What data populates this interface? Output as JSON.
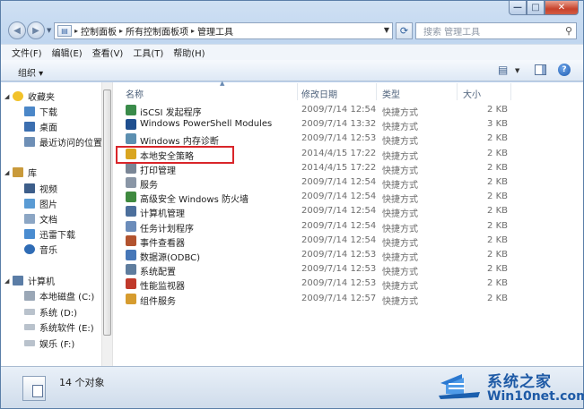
{
  "window": {
    "controls": {
      "minimize": "—",
      "maximize": "□",
      "close": "✕"
    },
    "buttons": {
      "back": "◀",
      "forward": "▶"
    }
  },
  "address": {
    "breadcrumbs": [
      "控制面板",
      "所有控制面板项",
      "管理工具"
    ],
    "separator": "▸",
    "root_icon": "folder-icon"
  },
  "search": {
    "placeholder": "搜索 管理工具",
    "icon": "magnifier-icon"
  },
  "menu": [
    "文件(F)",
    "编辑(E)",
    "查看(V)",
    "工具(T)",
    "帮助(H)"
  ],
  "toolbar": {
    "organize": "组织 ▾"
  },
  "nav": {
    "favorites": {
      "label": "收藏夹",
      "items": [
        "下载",
        "桌面",
        "最近访问的位置"
      ]
    },
    "libraries": {
      "label": "库",
      "items": [
        "视频",
        "图片",
        "文档",
        "迅雷下载",
        "音乐"
      ]
    },
    "computer": {
      "label": "计算机",
      "items": [
        "本地磁盘 (C:)",
        "系统 (D:)",
        "系统软件 (E:)",
        "娱乐 (F:)"
      ]
    }
  },
  "columns": {
    "name": "名称",
    "date": "修改日期",
    "type": "类型",
    "size": "大小"
  },
  "files": [
    {
      "name": "iSCSI 发起程序",
      "date": "2009/7/14 12:54",
      "type": "快捷方式",
      "size": "2 KB",
      "icon": "iscsi-icon",
      "color": "#3a8b4a"
    },
    {
      "name": "Windows PowerShell Modules",
      "date": "2009/7/14 13:32",
      "type": "快捷方式",
      "size": "3 KB",
      "icon": "powershell-icon",
      "color": "#1f4f8f"
    },
    {
      "name": "Windows 内存诊断",
      "date": "2009/7/14 12:53",
      "type": "快捷方式",
      "size": "2 KB",
      "icon": "memory-diagnostic-icon",
      "color": "#5c8fb0"
    },
    {
      "name": "本地安全策略",
      "date": "2014/4/15 17:22",
      "type": "快捷方式",
      "size": "2 KB",
      "icon": "security-policy-icon",
      "color": "#d9a520"
    },
    {
      "name": "打印管理",
      "date": "2014/4/15 17:22",
      "type": "快捷方式",
      "size": "2 KB",
      "icon": "print-icon",
      "color": "#7a8696"
    },
    {
      "name": "服务",
      "date": "2009/7/14 12:54",
      "type": "快捷方式",
      "size": "2 KB",
      "icon": "services-icon",
      "color": "#8a96a6"
    },
    {
      "name": "高级安全 Windows 防火墙",
      "date": "2009/7/14 12:54",
      "type": "快捷方式",
      "size": "2 KB",
      "icon": "firewall-icon",
      "color": "#3f8a3f"
    },
    {
      "name": "计算机管理",
      "date": "2009/7/14 12:54",
      "type": "快捷方式",
      "size": "2 KB",
      "icon": "computer-management-icon",
      "color": "#4c6f9c"
    },
    {
      "name": "任务计划程序",
      "date": "2009/7/14 12:54",
      "type": "快捷方式",
      "size": "2 KB",
      "icon": "task-scheduler-icon",
      "color": "#6b8cba"
    },
    {
      "name": "事件查看器",
      "date": "2009/7/14 12:54",
      "type": "快捷方式",
      "size": "2 KB",
      "icon": "event-viewer-icon",
      "color": "#b2532f"
    },
    {
      "name": "数据源(ODBC)",
      "date": "2009/7/14 12:53",
      "type": "快捷方式",
      "size": "2 KB",
      "icon": "odbc-icon",
      "color": "#4677b8"
    },
    {
      "name": "系统配置",
      "date": "2009/7/14 12:53",
      "type": "快捷方式",
      "size": "2 KB",
      "icon": "system-config-icon",
      "color": "#5f7d9e"
    },
    {
      "name": "性能监视器",
      "date": "2009/7/14 12:53",
      "type": "快捷方式",
      "size": "2 KB",
      "icon": "performance-monitor-icon",
      "color": "#c0392b"
    },
    {
      "name": "组件服务",
      "date": "2009/7/14 12:57",
      "type": "快捷方式",
      "size": "2 KB",
      "icon": "component-services-icon",
      "color": "#d69c2f"
    }
  ],
  "status": {
    "count": "14 个对象"
  },
  "watermark": {
    "title": "系统之家",
    "site": "Win10net.com"
  }
}
